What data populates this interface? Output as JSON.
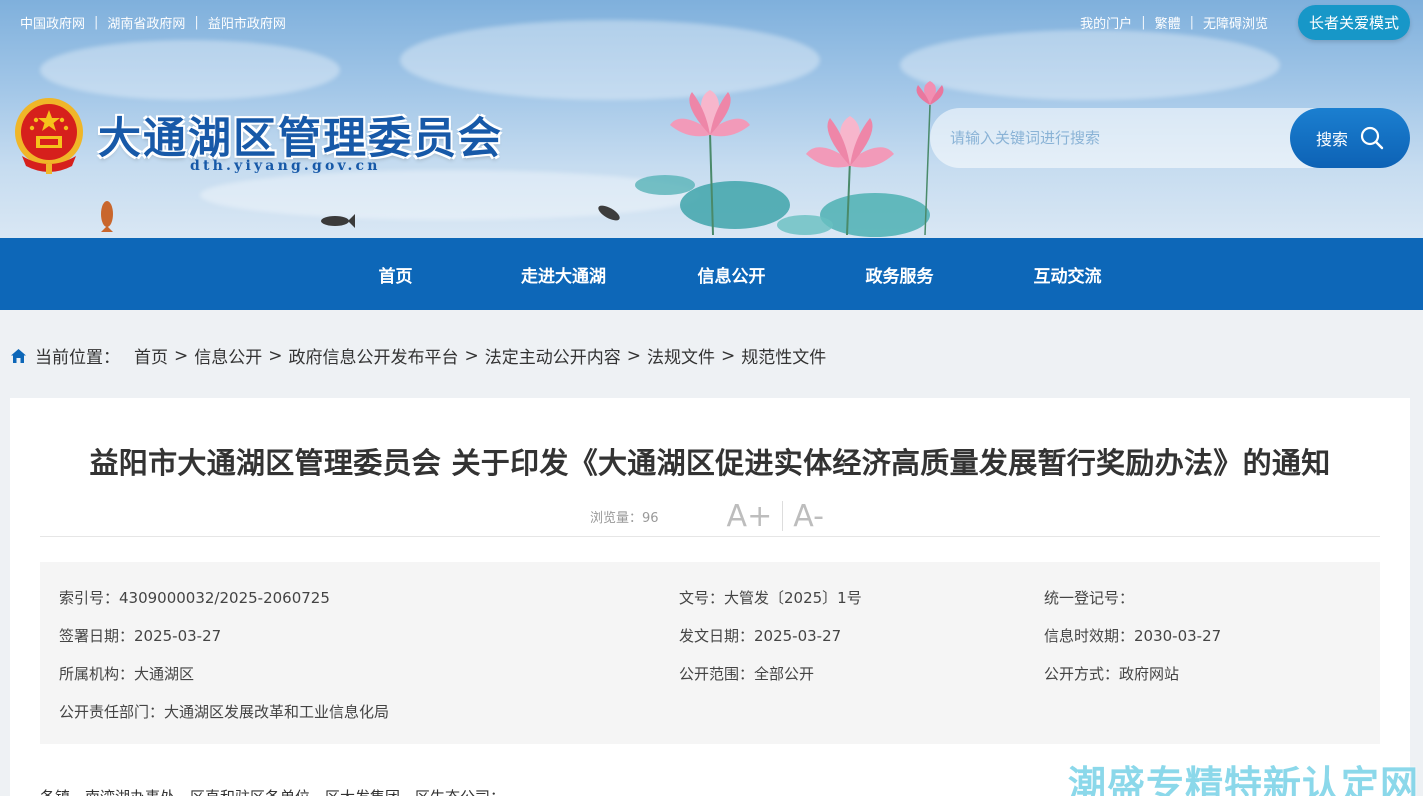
{
  "top_links": [
    "中国政府网",
    "湖南省政府网",
    "益阳市政府网"
  ],
  "right_links": [
    "我的门户",
    "繁體",
    "无障碍浏览"
  ],
  "elder_mode": "长者关爱模式",
  "site": {
    "name": "大通湖区管理委员会",
    "domain": "dth.yiyang.gov.cn"
  },
  "search": {
    "placeholder": "请输入关键词进行搜索",
    "button": "搜索"
  },
  "nav": [
    "首页",
    "走进大通湖",
    "信息公开",
    "政务服务",
    "互动交流"
  ],
  "breadcrumb": {
    "lead": "当前位置：",
    "items": [
      "首页",
      "信息公开",
      "政府信息公开发布平台",
      "法定主动公开内容",
      "法规文件",
      "规范性文件"
    ],
    "separator": ">"
  },
  "article": {
    "title": "益阳市大通湖区管理委员会 关于印发《大通湖区促进实体经济高质量发展暂行奖励办法》的通知",
    "views": "浏览量：96",
    "font_increase": "A+",
    "font_decrease": "A-"
  },
  "info": {
    "index_no": "索引号：4309000032/2025-2060725",
    "doc_no": "文号：大管发〔2025〕1号",
    "reg_no": "统一登记号：",
    "sign_date": "签署日期：2025-03-27",
    "issue_date": "发文日期：2025-03-27",
    "validity": "信息时效期：2030-03-27",
    "org": "所属机构：大通湖区",
    "scope": "公开范围：全部公开",
    "method": "公开方式：政府网站",
    "dept": "公开责任部门：大通湖区发展改革和工业信息化局"
  },
  "body_first_line": "各镇、南湾湖办事处，区直和驻区各单位，区大发集团、区生态公司：",
  "watermark": "潮盛专精特新认定网",
  "colors": {
    "nav": "#0d67b8",
    "title_text": "#1759a8",
    "elder_button": "#1797c8"
  }
}
